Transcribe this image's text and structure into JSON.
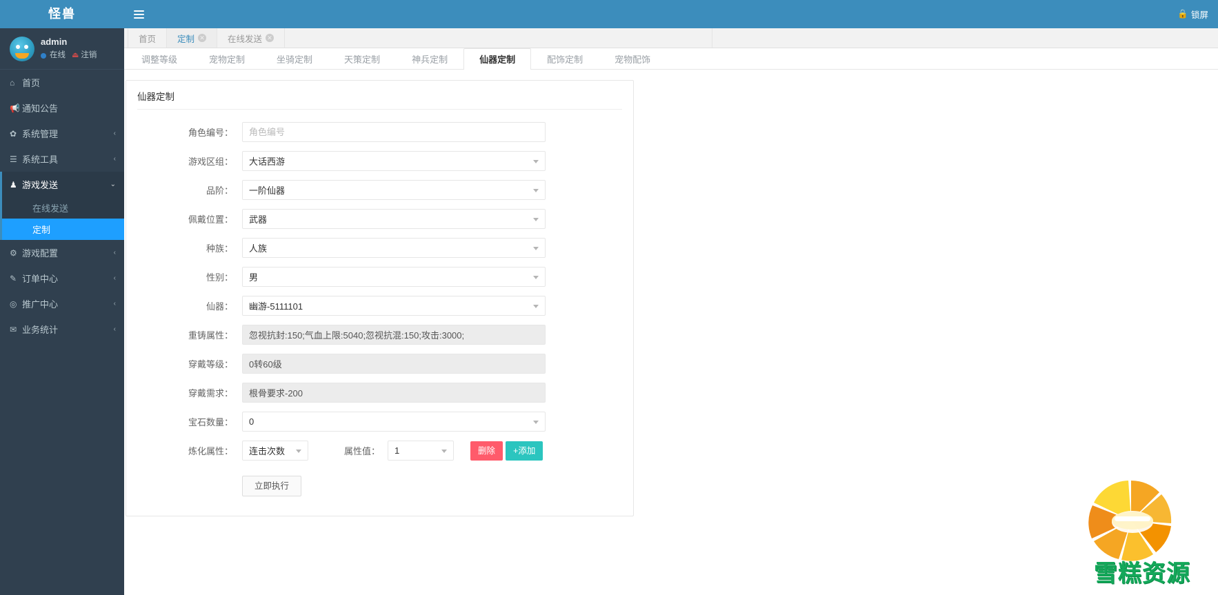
{
  "brand": {
    "title": "怪兽"
  },
  "user": {
    "name": "admin",
    "status": "在线",
    "logout": "注销"
  },
  "topbar": {
    "menu_toggle_icon": "hamburger-icon",
    "lock_label": "锁屏",
    "lock_icon": "lock-icon"
  },
  "window_tabs": {
    "collapse_icon": "double-chevron-left-icon",
    "items": [
      {
        "label": "首页",
        "closable": false,
        "active": false
      },
      {
        "label": "定制",
        "closable": true,
        "active": true
      },
      {
        "label": "在线发送",
        "closable": true,
        "active": false
      }
    ]
  },
  "sidebar": {
    "items": [
      {
        "label": "首页",
        "icon": "home-icon",
        "arrow": "",
        "state": ""
      },
      {
        "label": "通知公告",
        "icon": "megaphone-icon",
        "arrow": "",
        "state": ""
      },
      {
        "label": "系统管理",
        "icon": "gear-icon",
        "arrow": "‹",
        "state": ""
      },
      {
        "label": "系统工具",
        "icon": "list-icon",
        "arrow": "‹",
        "state": ""
      },
      {
        "label": "游戏发送",
        "icon": "gamepad-icon",
        "arrow": "⌄",
        "state": "open"
      },
      {
        "label": "游戏配置",
        "icon": "sliders-icon",
        "arrow": "‹",
        "state": ""
      },
      {
        "label": "订单中心",
        "icon": "pen-icon",
        "arrow": "‹",
        "state": ""
      },
      {
        "label": "推广中心",
        "icon": "eye-icon",
        "arrow": "‹",
        "state": ""
      },
      {
        "label": "业务统计",
        "icon": "envelope-icon",
        "arrow": "‹",
        "state": ""
      }
    ],
    "submenu": [
      {
        "label": "在线发送",
        "active": false
      },
      {
        "label": "定制",
        "active": true
      }
    ]
  },
  "content_tabs": [
    {
      "label": "调整等级",
      "active": false
    },
    {
      "label": "宠物定制",
      "active": false
    },
    {
      "label": "坐骑定制",
      "active": false
    },
    {
      "label": "天策定制",
      "active": false
    },
    {
      "label": "神兵定制",
      "active": false
    },
    {
      "label": "仙器定制",
      "active": true
    },
    {
      "label": "配饰定制",
      "active": false
    },
    {
      "label": "宠物配饰",
      "active": false
    }
  ],
  "panel": {
    "title": "仙器定制",
    "fields": {
      "role_id": {
        "label": "角色编号：",
        "value": "",
        "placeholder": "角色编号"
      },
      "server": {
        "label": "游戏区组：",
        "value": "大话西游"
      },
      "grade": {
        "label": "品阶：",
        "value": "一阶仙器"
      },
      "slot": {
        "label": "佩戴位置：",
        "value": "武器"
      },
      "race": {
        "label": "种族：",
        "value": "人族"
      },
      "gender": {
        "label": "性别：",
        "value": "男"
      },
      "artifact": {
        "label": "仙器：",
        "value": "幽游-5111101"
      },
      "recast_attrs": {
        "label": "重铸属性：",
        "value": "忽视抗封:150;气血上限:5040;忽视抗混:150;攻击:3000;"
      },
      "wear_level": {
        "label": "穿戴等级：",
        "value": "0转60级"
      },
      "wear_req": {
        "label": "穿戴需求：",
        "value": "根骨要求-200"
      },
      "gem_count": {
        "label": "宝石数量：",
        "value": "0"
      },
      "refine_attr": {
        "label": "炼化属性：",
        "value": "连击次数"
      },
      "attr_value": {
        "label": "属性值：",
        "value": "1"
      }
    },
    "buttons": {
      "delete": "删除",
      "add": "+添加",
      "submit": "立即执行"
    }
  },
  "watermark": {
    "text": "雪糕资源"
  },
  "colors": {
    "brand_blue": "#3c8dbc",
    "sidebar_bg": "#30404f",
    "active_submenu": "#1e9fff",
    "danger": "#ff5b6b",
    "teal": "#2bc5bf",
    "watermark_green": "#14a85a"
  }
}
